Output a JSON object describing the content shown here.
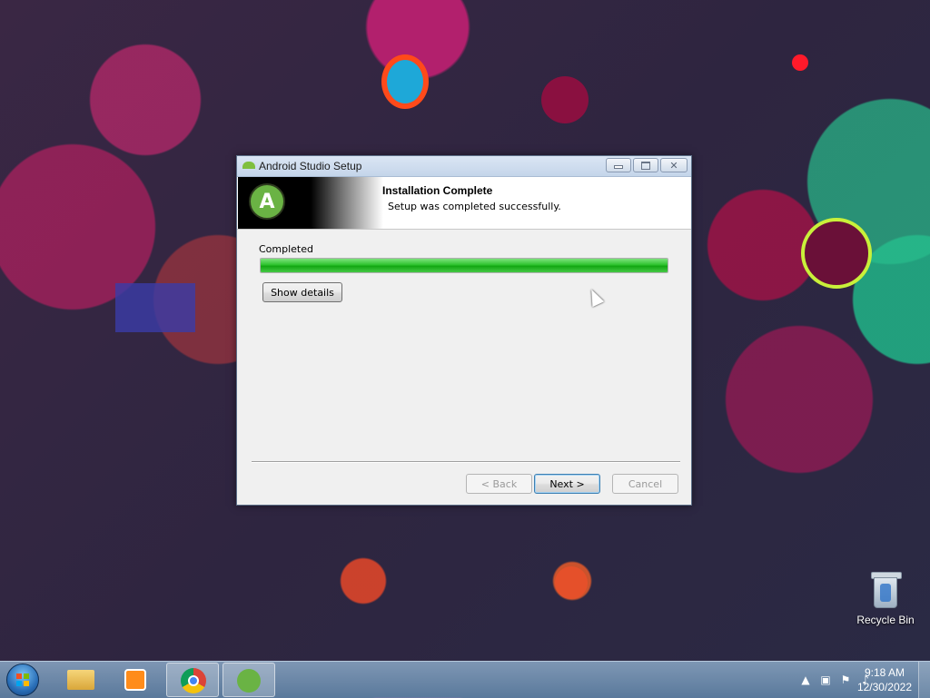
{
  "window": {
    "title": "Android Studio Setup",
    "controls": {
      "minimize": "minimize",
      "maximize": "maximize",
      "close": "✕"
    }
  },
  "header": {
    "title": "Installation Complete",
    "subtitle": "Setup was completed successfully."
  },
  "progress": {
    "label": "Completed",
    "percent": 100
  },
  "buttons": {
    "show_details": "Show details",
    "back": "< Back",
    "next": "Next >",
    "cancel": "Cancel"
  },
  "desktop": {
    "icons": [
      {
        "label": "Recycle Bin"
      }
    ]
  },
  "taskbar": {
    "items": [
      "Windows Explorer",
      "Windows Media Player",
      "Google Chrome",
      "Android Studio Setup"
    ],
    "clock": {
      "time": "9:18 AM",
      "date": "12/30/2022"
    },
    "tray_icons": [
      "show-hidden-icons",
      "network-icon",
      "action-center-flag-icon",
      "volume-icon"
    ]
  },
  "colors": {
    "progress_fill": "#13a713",
    "android_green": "#6ab344"
  }
}
